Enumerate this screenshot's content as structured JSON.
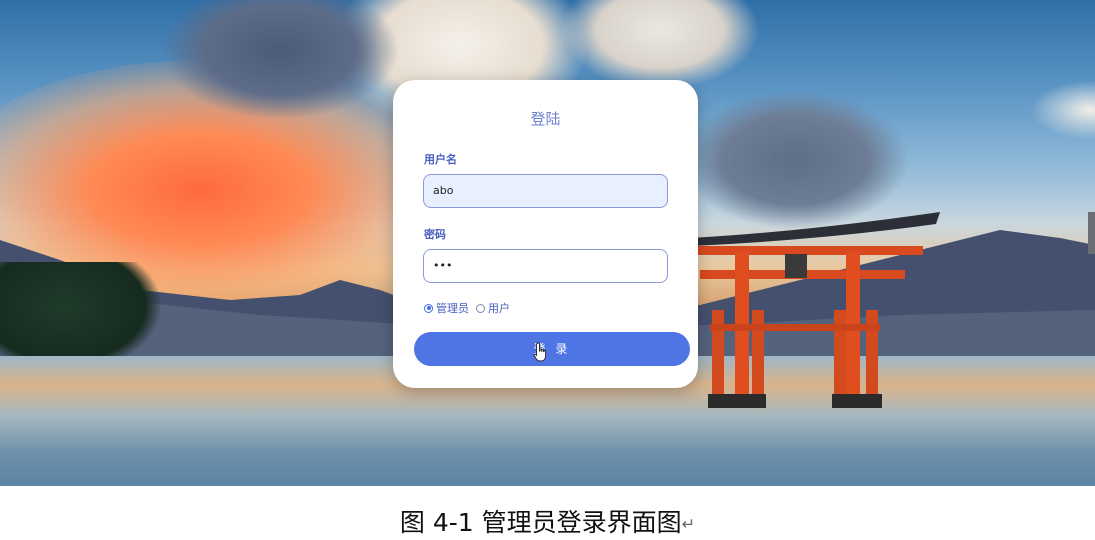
{
  "login_card": {
    "title": "登陆",
    "username_label": "用户名",
    "username_value": "abo",
    "password_label": "密码",
    "password_value": "•••",
    "roles": [
      {
        "label": "管理员",
        "selected": true
      },
      {
        "label": "用户",
        "selected": false
      }
    ],
    "submit_label": "登 录"
  },
  "caption": {
    "text": "图 4-1 管理员登录界面图",
    "return_mark": "↵"
  },
  "colors": {
    "accent": "#4f74e3",
    "label": "#4a5fc1",
    "input_fill": "#e8efff"
  },
  "icons": [
    "hand-pointer-icon",
    "radio-selected-icon",
    "radio-unselected-icon"
  ]
}
